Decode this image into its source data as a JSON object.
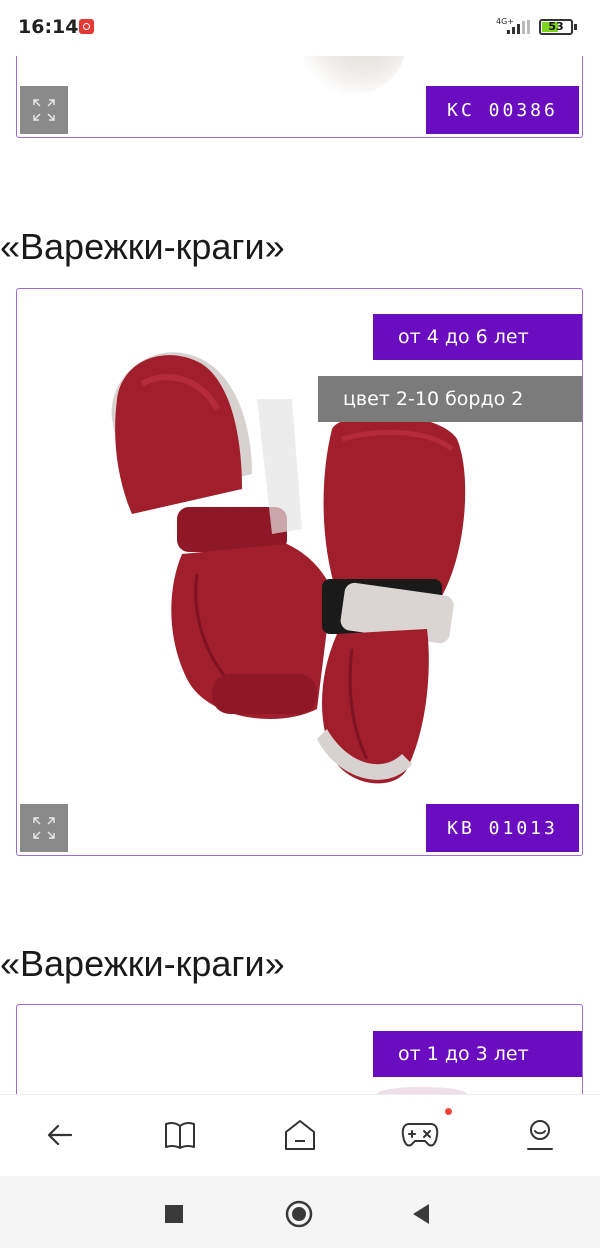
{
  "status_bar": {
    "time": "16:14",
    "network": "4G+",
    "battery": "53"
  },
  "cards": [
    {
      "code": "KC 00386"
    },
    {
      "title": "«Варежки-краги»",
      "age": "от 4 до 6 лет",
      "color": "цвет 2-10 бордо 2",
      "code": "KB 01013"
    },
    {
      "title": "«Варежки-краги»",
      "age": "от 1 до 3 лет"
    }
  ],
  "bottom_nav": {
    "icons": [
      "back-arrow-icon",
      "book-icon",
      "home-icon",
      "gamepad-icon",
      "profile-icon"
    ],
    "notification_color": "#f44336"
  },
  "system_nav": {
    "icons": [
      "recents-square-icon",
      "home-circle-icon",
      "back-triangle-icon"
    ]
  },
  "colors": {
    "accent": "#6a0dc0",
    "gray_tag": "#7b7b7b",
    "product_red": "#a0202c",
    "card_border": "#9c6bd8"
  }
}
